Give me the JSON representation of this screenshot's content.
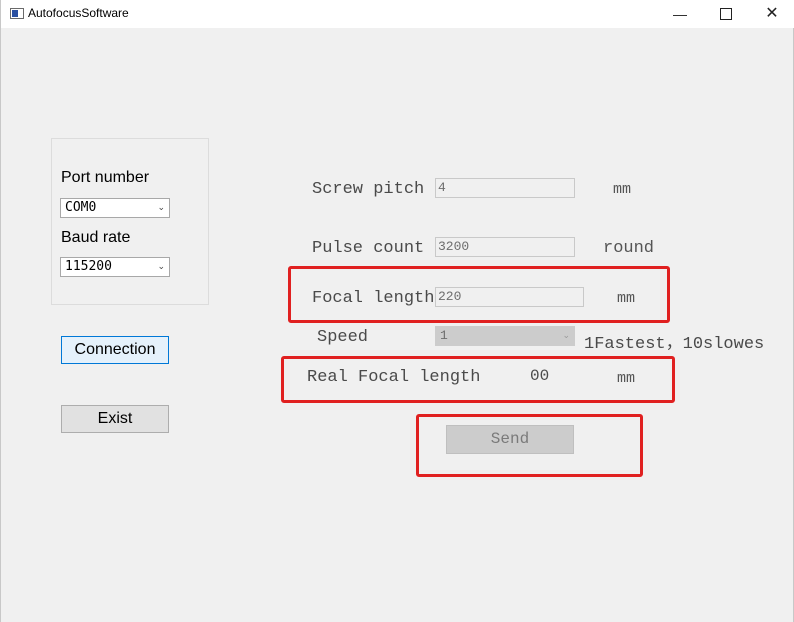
{
  "window": {
    "title": "AutofocusSoftware",
    "controls": {
      "minimize": "—",
      "close": "✕"
    }
  },
  "connection": {
    "port_label": "Port number",
    "port_value": "COM0",
    "baud_label": "Baud rate",
    "baud_value": "115200",
    "connect_button": "Connection",
    "exit_button": "Exist"
  },
  "form": {
    "screw_pitch": {
      "label": "Screw pitch",
      "value": "4",
      "unit": "mm"
    },
    "pulse_count": {
      "label": "Pulse count",
      "value": "3200",
      "unit": "round"
    },
    "focal_length": {
      "label": "Focal length",
      "value": "220",
      "unit": "mm"
    },
    "speed": {
      "label": "Speed",
      "value": "1",
      "hint": "1Fastest，10slowes"
    },
    "real_focal_length": {
      "label": "Real Focal length",
      "value": "00",
      "unit": "mm"
    },
    "send_button": "Send"
  },
  "colors": {
    "highlight": "#e02020",
    "focus": "#0078d7"
  }
}
